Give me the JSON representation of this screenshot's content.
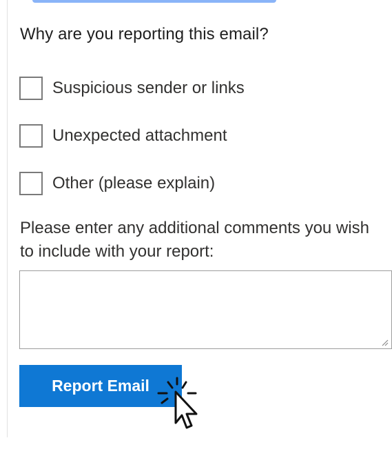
{
  "form": {
    "question": "Why are you reporting this email?",
    "options": [
      {
        "label": "Suspicious sender or links",
        "checked": false
      },
      {
        "label": "Unexpected attachment",
        "checked": false
      },
      {
        "label": "Other (please explain)",
        "checked": false
      }
    ],
    "comments_label": "Please enter any additional comments you wish to include with your report:",
    "comments_value": "",
    "submit_label": "Report Email"
  },
  "colors": {
    "button": "#0f78d4",
    "button_text": "#ffffff",
    "checkbox_border": "#7a7a7a",
    "text": "#323130"
  },
  "icons": {
    "cursor": "pointer-arrow-icon",
    "click_effect": "click-burst-icon",
    "resize": "resize-grip-icon"
  }
}
